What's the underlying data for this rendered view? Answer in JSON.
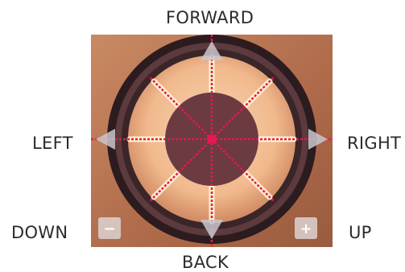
{
  "labels": {
    "forward": "FORWARD",
    "left": "LEFT",
    "right": "RIGHT",
    "down": "DOWN",
    "up": "UP",
    "back": "BACK"
  },
  "buttons": {
    "minus": "−",
    "plus": "+"
  },
  "colors": {
    "wood": "#b57451",
    "rim_outer": "#3a2528",
    "rim_mid": "#5a3a3e",
    "disc": "#f1b98d",
    "spokes": "#fff6d6",
    "center_dark": "#6b3b41",
    "reticle": "#e8174f",
    "arrow_gray": "#c9c7ce",
    "button_bg": "#ddd2d2",
    "text": "#2b2b2b"
  }
}
